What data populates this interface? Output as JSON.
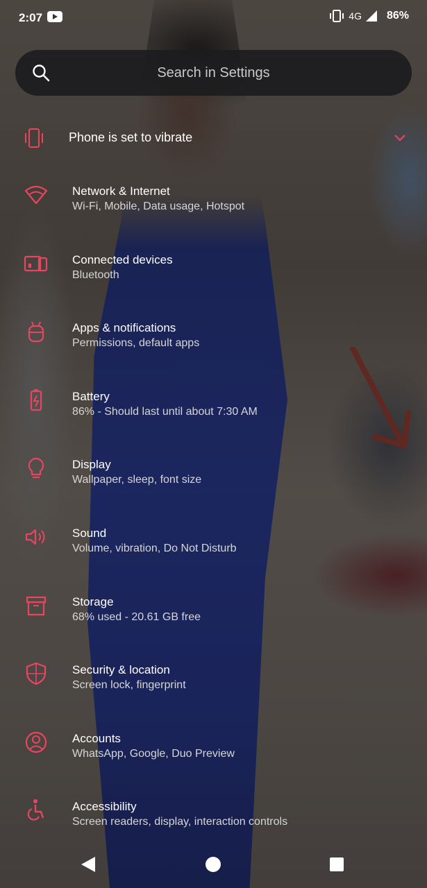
{
  "status_bar": {
    "time": "2:07",
    "network": "4G",
    "battery": "86%",
    "icons": [
      "youtube-icon",
      "vibrate-icon",
      "signal-icon"
    ]
  },
  "search": {
    "placeholder": "Search in Settings"
  },
  "vibrate_banner": {
    "label": "Phone is set to vibrate",
    "icon": "vibrate-icon"
  },
  "theme": {
    "accent": "#e8455f"
  },
  "settings": [
    {
      "title": "Network & Internet",
      "subtitle": "Wi-Fi, Mobile, Data usage, Hotspot",
      "icon": "wifi-icon"
    },
    {
      "title": "Connected devices",
      "subtitle": "Bluetooth",
      "icon": "devices-icon"
    },
    {
      "title": "Apps & notifications",
      "subtitle": "Permissions, default apps",
      "icon": "android-icon"
    },
    {
      "title": "Battery",
      "subtitle": "86% - Should last until about 7:30 AM",
      "icon": "battery-icon"
    },
    {
      "title": "Display",
      "subtitle": "Wallpaper, sleep, font size",
      "icon": "lightbulb-icon"
    },
    {
      "title": "Sound",
      "subtitle": "Volume, vibration, Do Not Disturb",
      "icon": "speaker-icon"
    },
    {
      "title": "Storage",
      "subtitle": "68% used - 20.61 GB free",
      "icon": "storage-icon"
    },
    {
      "title": "Security & location",
      "subtitle": "Screen lock, fingerprint",
      "icon": "shield-icon"
    },
    {
      "title": "Accounts",
      "subtitle": "WhatsApp, Google, Duo Preview",
      "icon": "account-icon"
    },
    {
      "title": "Accessibility",
      "subtitle": "Screen readers, display, interaction controls",
      "icon": "accessibility-icon"
    }
  ]
}
